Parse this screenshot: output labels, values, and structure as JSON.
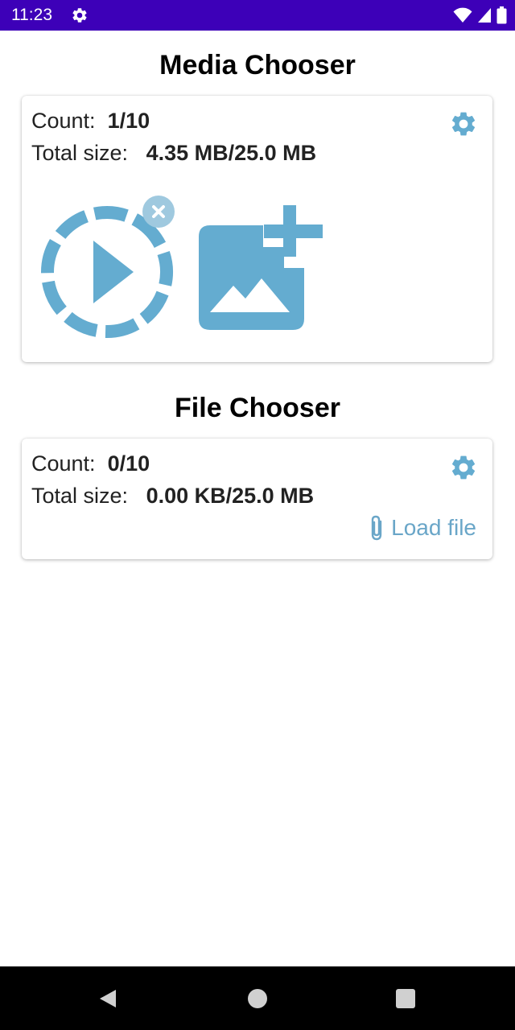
{
  "status_bar": {
    "time": "11:23",
    "icons": [
      "settings-icon",
      "wifi-icon",
      "signal-icon",
      "battery-icon"
    ],
    "background": "#3d00b8"
  },
  "media_chooser": {
    "title": "Media Chooser",
    "count_label": "Count:",
    "count_value": "1/10",
    "size_label": "Total size:",
    "size_value": "4.35 MB/25.0 MB",
    "items": [
      {
        "icon": "video-play-icon",
        "removable": true
      }
    ],
    "add_icon": "add-image-icon"
  },
  "file_chooser": {
    "title": "File Chooser",
    "count_label": "Count:",
    "count_value": "0/10",
    "size_label": "Total size:",
    "size_value": "0.00 KB/25.0 MB",
    "load_label": "Load file",
    "load_icon": "paperclip-icon"
  },
  "colors": {
    "accent": "#6aa6c8",
    "icon_blue": "#64acd0"
  },
  "nav_bar": {
    "buttons": [
      "back-icon",
      "home-icon",
      "recents-icon"
    ]
  }
}
